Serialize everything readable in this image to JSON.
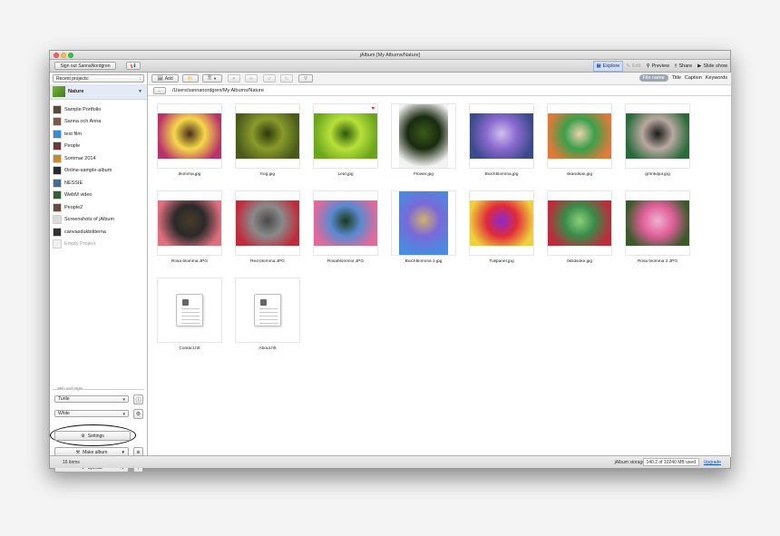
{
  "window": {
    "title": "jAlbum [My Albums/Nature]"
  },
  "toolbar": {
    "sign_out_label": "Sign out SannaNordgren",
    "announce_icon": "megaphone-icon",
    "modes": [
      {
        "label": "Explore",
        "icon": "explore-icon",
        "state": "active"
      },
      {
        "label": "Edit",
        "icon": "pencil-icon",
        "state": "disabled"
      },
      {
        "label": "Preview",
        "icon": "magnifier-icon",
        "state": "normal"
      },
      {
        "label": "Share",
        "icon": "share-icon",
        "state": "normal"
      },
      {
        "label": "Slide show",
        "icon": "play-icon",
        "state": "normal"
      }
    ]
  },
  "sidebar": {
    "recent_label": "Recent projects:",
    "current_project": "Nature",
    "projects": [
      {
        "label": "Sample Portfolio",
        "color": "#5a4a3a"
      },
      {
        "label": "Sanna och Anna",
        "color": "#7a5a4a"
      },
      {
        "label": "test film",
        "color": "#3a8ad0"
      },
      {
        "label": "People",
        "color": "#6a3a3a"
      },
      {
        "label": "Sommar 2014",
        "color": "#c08a3a"
      },
      {
        "label": "Online-sample-album",
        "color": "#2a2a2a"
      },
      {
        "label": "NESSIE",
        "color": "#4a6a8a"
      },
      {
        "label": "WebM video",
        "color": "#3a5a3a"
      },
      {
        "label": "People2",
        "color": "#6a4a3a"
      },
      {
        "label": "Screenshots of jAlbum",
        "color": "#dcdcdc"
      },
      {
        "label": "canvasdukbilderna",
        "color": "#333333"
      },
      {
        "label": "Empty Project",
        "color": "#f0f0f0"
      }
    ],
    "skin_section_label": "Skin and style",
    "skin_value": "Turtle",
    "style_value": "White",
    "settings_label": "Settings",
    "make_album_label": "Make album",
    "upload_label": "Upload"
  },
  "main": {
    "toolbar": {
      "add_label": "Add",
      "sort_options": [
        {
          "label": "File name",
          "state": "active"
        },
        {
          "label": "Title",
          "state": "normal"
        },
        {
          "label": "Caption",
          "state": "normal"
        },
        {
          "label": "Keywords",
          "state": "normal"
        }
      ]
    },
    "path": "/Users/sannanordgren/My Albums/Nature",
    "items": [
      {
        "caption": "blomma.jpg",
        "type": "photo",
        "orientation": "landscape",
        "colors": [
          "#f5d94a",
          "#b8326a",
          "#4a2e1a"
        ]
      },
      {
        "caption": "frog.jpg",
        "type": "photo",
        "orientation": "landscape",
        "colors": [
          "#8a9a2a",
          "#4a5a1a",
          "#2a3a0a"
        ]
      },
      {
        "caption": "Leaf.jpg",
        "type": "photo",
        "orientation": "landscape",
        "colors": [
          "#b8e03a",
          "#6aa51c",
          "#2e5a08"
        ],
        "favorite": true
      },
      {
        "caption": "Flower.jpg",
        "type": "photo",
        "orientation": "portrait",
        "colors": [
          "#1a2a10",
          "#f2f2f2",
          "#3a5a1a"
        ]
      },
      {
        "caption": "Biochblomma.jpg",
        "type": "photo",
        "orientation": "landscape",
        "colors": [
          "#8a6ad0",
          "#3a4a8a",
          "#d0c0f0"
        ]
      },
      {
        "caption": "skandsax.jpg",
        "type": "photo",
        "orientation": "landscape",
        "colors": [
          "#3aa04a",
          "#e07a3a",
          "#f0d0b0"
        ]
      },
      {
        "caption": "grönkdjur.jpg",
        "type": "photo",
        "orientation": "landscape",
        "colors": [
          "#b8a8a0",
          "#2a6a3a",
          "#1a1a1a"
        ]
      },
      {
        "caption": "Rosa blomma.JPG",
        "type": "photo",
        "orientation": "landscape",
        "colors": [
          "#2a2a2a",
          "#e07080",
          "#4a3a2a"
        ]
      },
      {
        "caption": "Red blomma.JPG",
        "type": "photo",
        "orientation": "landscape",
        "colors": [
          "#8a8a8a",
          "#c02a3a",
          "#4a4a4a"
        ]
      },
      {
        "caption": "Rosablommor.JPG",
        "type": "photo",
        "orientation": "landscape",
        "colors": [
          "#5a8ad0",
          "#e06a9a",
          "#1a3a1a"
        ]
      },
      {
        "caption": "Biochblomma 2.jpg",
        "type": "photo",
        "orientation": "portrait",
        "colors": [
          "#7a6ad8",
          "#4a8ae0",
          "#d0b070"
        ]
      },
      {
        "caption": "Tulipaner.jpg",
        "type": "photo",
        "orientation": "landscape",
        "colors": [
          "#e02a3a",
          "#f0d03a",
          "#8a2ad0"
        ]
      },
      {
        "caption": "öktidsoke.jpg",
        "type": "photo",
        "orientation": "landscape",
        "colors": [
          "#3a8a4a",
          "#c02a3a",
          "#8ad07a"
        ]
      },
      {
        "caption": "Rosa blomma 2.JPG",
        "type": "photo",
        "orientation": "landscape",
        "colors": [
          "#e0609a",
          "#3a5a2a",
          "#f0b0d0"
        ]
      },
      {
        "caption": "Contact.htt",
        "type": "doc"
      },
      {
        "caption": "About.htt",
        "type": "doc"
      }
    ]
  },
  "status": {
    "items_label": "16 items",
    "storage_label": "jAlbum storage",
    "usage_label": "140.2 of 10240 MB used",
    "upgrade_label": "Upgrade"
  }
}
